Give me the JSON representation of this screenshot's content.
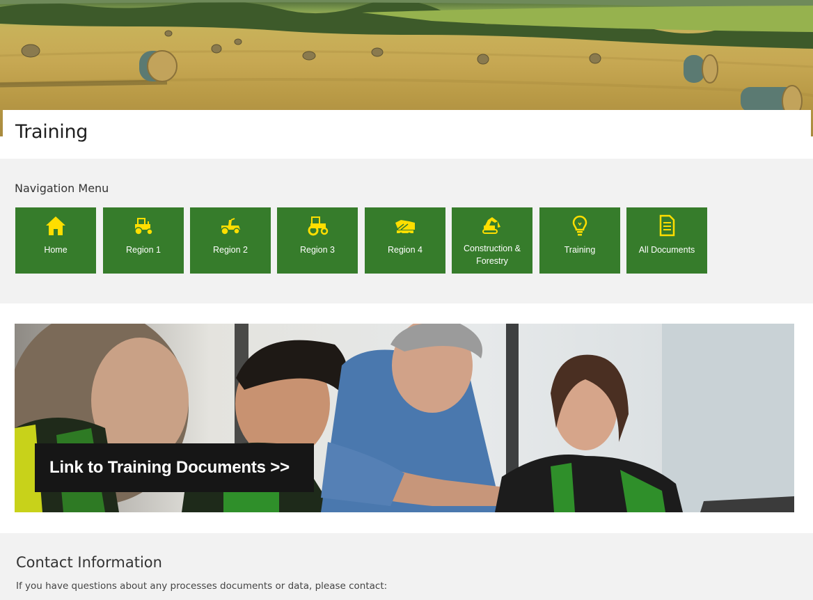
{
  "page": {
    "title": "Training"
  },
  "navigation": {
    "heading": "Navigation Menu",
    "tile_color": "#367c2b",
    "icon_color": "#ffde00",
    "items": [
      {
        "label": "Home",
        "icon": "home-icon"
      },
      {
        "label": "Region 1",
        "icon": "tractor-icon"
      },
      {
        "label": "Region 2",
        "icon": "lawn-tractor-icon"
      },
      {
        "label": "Region 3",
        "icon": "tractor-icon"
      },
      {
        "label": "Region 4",
        "icon": "combine-icon"
      },
      {
        "label": "Construction & Forestry",
        "icon": "excavator-icon"
      },
      {
        "label": "Training",
        "icon": "lightbulb-icon"
      },
      {
        "label": "All Documents",
        "icon": "document-icon"
      }
    ]
  },
  "feature": {
    "link_text": "Link to Training Documents >>"
  },
  "contact": {
    "heading": "Contact Information",
    "text": "If you have questions about any processes documents or data, please contact:"
  }
}
